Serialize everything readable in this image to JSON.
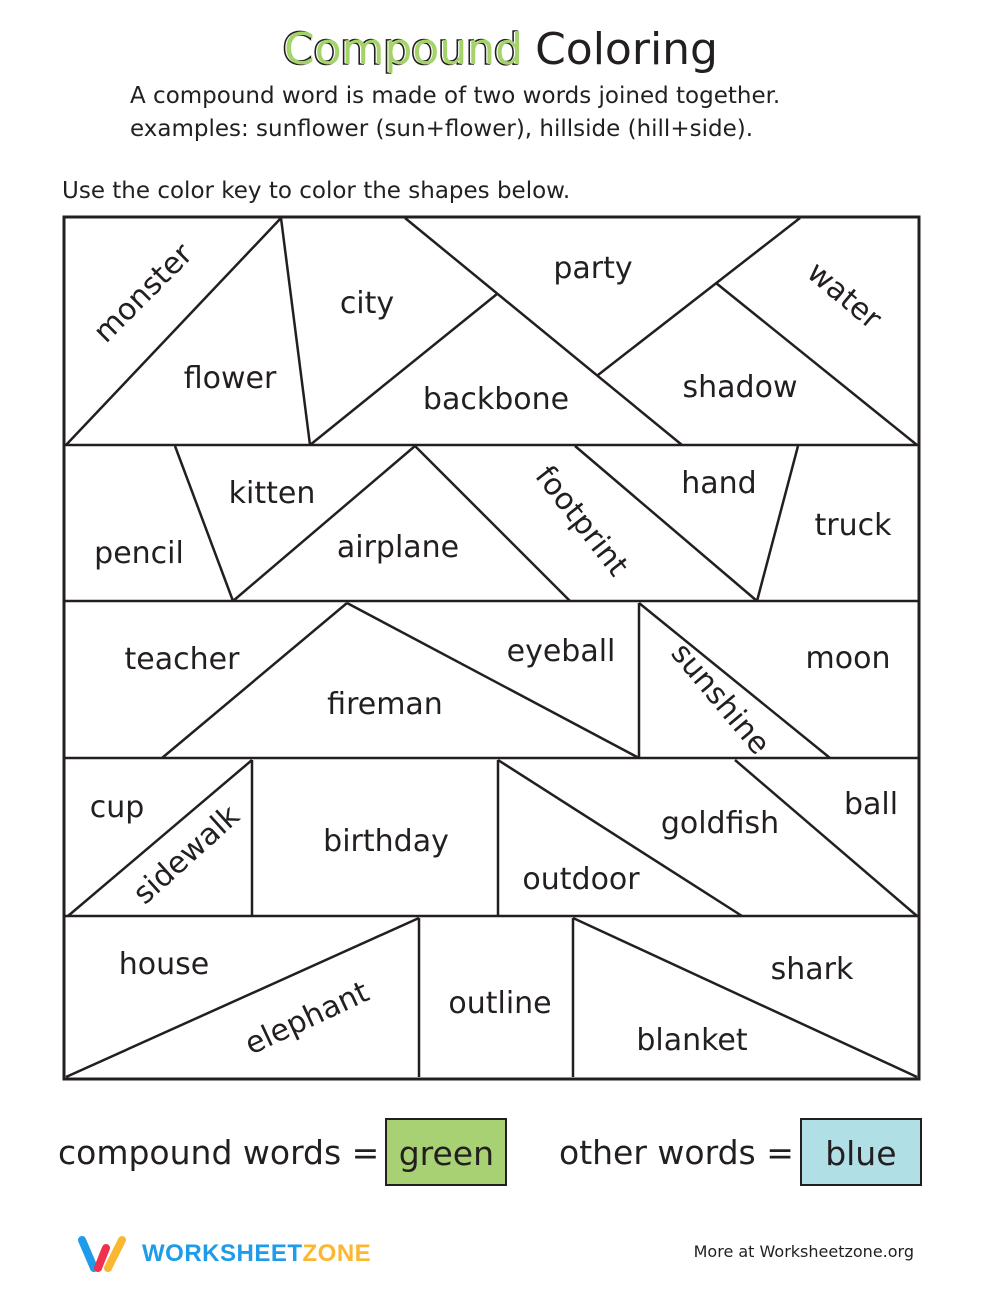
{
  "header": {
    "title_outline": "Compound",
    "title_rest": "Coloring",
    "intro_line1": "A compound word is made of two words joined together.",
    "intro_line2": "examples: sunflower (sun+flower), hillside (hill+side).",
    "instructions": "Use the color key to color the shapes below."
  },
  "puzzle": {
    "rows": [
      [
        "monster",
        "flower",
        "city",
        "party",
        "backbone",
        "water",
        "shadow"
      ],
      [
        "pencil",
        "kitten",
        "airplane",
        "footprint",
        "hand",
        "truck"
      ],
      [
        "teacher",
        "fireman",
        "eyeball",
        "sunshine",
        "moon"
      ],
      [
        "cup",
        "sidewalk",
        "birthday",
        "outdoor",
        "goldfish",
        "ball"
      ],
      [
        "house",
        "elephant",
        "outline",
        "shark",
        "blanket"
      ]
    ]
  },
  "key": {
    "compound_label": "compound words =",
    "compound_color_name": "green",
    "compound_color": "#a8d173",
    "other_label": "other words =",
    "other_color_name": "blue",
    "other_color": "#b1dfe6"
  },
  "footer": {
    "brand_part1": "WORKSHEET",
    "brand_part2": "ZONE",
    "brand_color1": "#1e9be9",
    "brand_color2": "#fbb731",
    "more_text": "More at Worksheetzone.org"
  }
}
